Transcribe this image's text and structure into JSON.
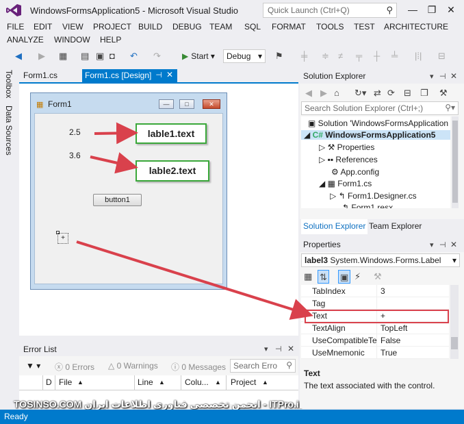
{
  "window": {
    "title": "WindowsFormsApplication5 - Microsoft Visual Studio",
    "quick_launch": "Quick Launch (Ctrl+Q)",
    "minimize": "—",
    "restore": "❐",
    "close": "✕"
  },
  "menu": [
    "FILE",
    "EDIT",
    "VIEW",
    "PROJECT",
    "BUILD",
    "DEBUG",
    "TEAM",
    "SQL",
    "FORMAT",
    "TOOLS",
    "TEST",
    "ARCHITECTURE",
    "ANALYZE",
    "WINDOW",
    "HELP"
  ],
  "toolbar": {
    "start": "Start",
    "config": "Debug"
  },
  "side_tabs": [
    "Toolbox",
    "Data Sources"
  ],
  "doc_tabs": [
    "Form1.cs",
    "Form1.cs [Design]"
  ],
  "form": {
    "title": "Form1",
    "label1": "2.5",
    "label2": "3.6",
    "button1": "button1",
    "label3": "+"
  },
  "callouts": {
    "c1": "lable1.text",
    "c2": "lable2.text"
  },
  "error_list": {
    "title": "Error List",
    "errors": "0 Errors",
    "warnings": "0 Warnings",
    "messages": "0 Messages",
    "search": "Search Erro",
    "columns": [
      "D",
      "File",
      "Line",
      "Colu...",
      "Project"
    ]
  },
  "solution_explorer": {
    "title": "Solution Explorer",
    "search": "Search Solution Explorer (Ctrl+;)",
    "tree": [
      "Solution 'WindowsFormsApplication",
      "WindowsFormsApplication5",
      "Properties",
      "References",
      "App.config",
      "Form1.cs",
      "Form1.Designer.cs",
      "Form1.resx"
    ],
    "tabs": [
      "Solution Explorer",
      "Team Explorer"
    ]
  },
  "properties": {
    "title": "Properties",
    "object": "label3",
    "object_type": "System.Windows.Forms.Label",
    "rows": [
      {
        "name": "TabIndex",
        "value": "3"
      },
      {
        "name": "Tag",
        "value": ""
      },
      {
        "name": "Text",
        "value": "+"
      },
      {
        "name": "TextAlign",
        "value": "TopLeft"
      },
      {
        "name": "UseCompatibleTe",
        "value": "False"
      },
      {
        "name": "UseMnemonic",
        "value": "True"
      }
    ],
    "desc_name": "Text",
    "desc_text": "The text associated with the control."
  },
  "watermark": "TOSINSO.COM                    انجمن تخصصی فناوری اطلاعات ایران - ITPro.ir",
  "status": "Ready",
  "colors": {
    "accent": "#007acc",
    "callout_border": "#3aa83a",
    "arrow": "#d9414c"
  }
}
